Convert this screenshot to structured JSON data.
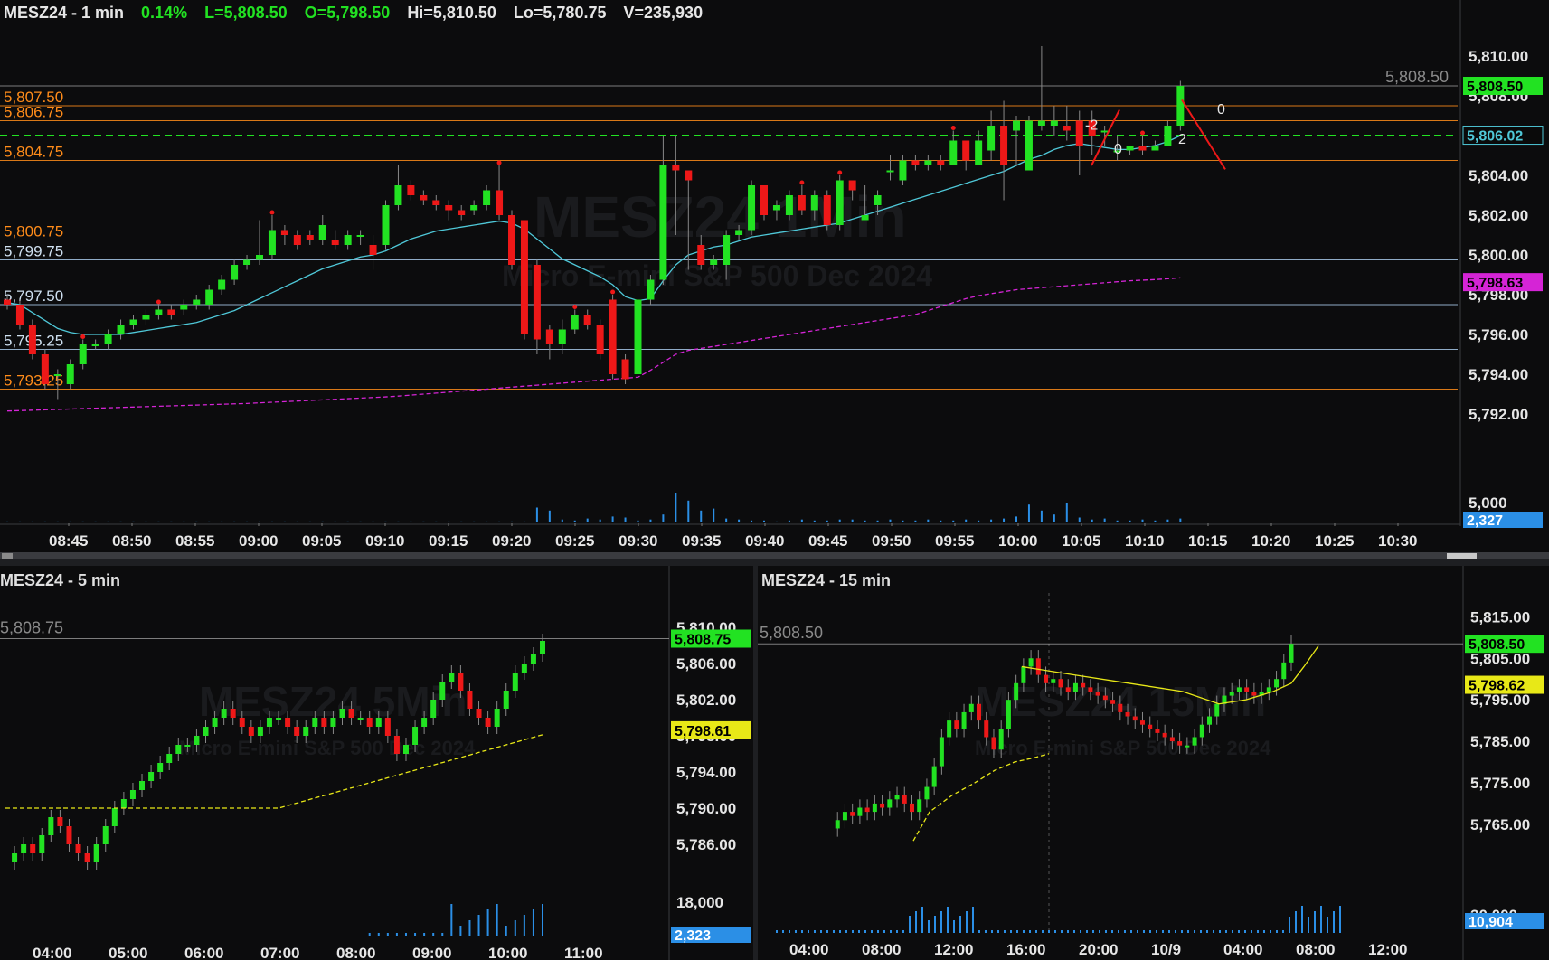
{
  "colors": {
    "up": "#22e222",
    "down": "#ee1818",
    "orange": "#ff8c1a",
    "grid": "#2a2c30",
    "ema_short": "#4fc8d8",
    "ema_long": "#d524d6",
    "yellow": "#e8e817",
    "volume": "#2b8fe6"
  },
  "chart_data": [
    {
      "type": "candlestick",
      "title": "MESZ24 - 1 min",
      "header": {
        "symbol": "MESZ24 - 1 min",
        "change": "0.14%",
        "last": "L=5,808.50",
        "open": "O=5,798.50",
        "high": "Hi=5,810.50",
        "low": "Lo=5,780.75",
        "volume": "V=235,930"
      },
      "watermark": {
        "symbol": "MESZ24 1Min",
        "name": "Micro E-mini S&P 500 Dec 2024"
      },
      "ylim": [
        5791,
        5811
      ],
      "y_ticks": [
        "5,810.00",
        "5,808.00",
        "5,806.00",
        "5,804.00",
        "5,802.00",
        "5,800.00",
        "5,798.00",
        "5,796.00",
        "5,794.00",
        "5,792.00"
      ],
      "x_ticks": [
        "08:45",
        "08:50",
        "08:55",
        "09:00",
        "09:05",
        "09:10",
        "09:15",
        "09:20",
        "09:25",
        "09:30",
        "09:35",
        "09:40",
        "09:45",
        "09:50",
        "09:55",
        "10:00",
        "10:05",
        "10:10",
        "10:15",
        "10:20",
        "10:25",
        "10:30"
      ],
      "levels": [
        {
          "label": "5,807.50",
          "value": 5807.5,
          "color": "orange"
        },
        {
          "label": "5,806.75",
          "value": 5806.75,
          "color": "orange"
        },
        {
          "label": "5,804.75",
          "value": 5804.75,
          "color": "orange"
        },
        {
          "label": "5,800.75",
          "value": 5800.75,
          "color": "orange"
        },
        {
          "label": "5,799.75",
          "value": 5799.75,
          "color": "white"
        },
        {
          "label": "5,797.50",
          "value": 5797.5,
          "color": "white"
        },
        {
          "label": "5,795.25",
          "value": 5795.25,
          "color": "white"
        },
        {
          "label": "5,793.25",
          "value": 5793.25,
          "color": "orange"
        }
      ],
      "last_price_line": "5,808.50",
      "price_tags": [
        {
          "text": "5,808.50",
          "bg": "#22e222",
          "fg": "#000",
          "value": 5808.5
        },
        {
          "text": "5,806.02",
          "bg": "#0a0a0a",
          "fg": "#4fc8d8",
          "value": 5806.02
        },
        {
          "text": "5,798.63",
          "bg": "#d524d6",
          "fg": "#000",
          "value": 5798.63
        }
      ],
      "volume_tick": "5,000",
      "volume_tag": "2,327",
      "swing_labels": [
        "-2",
        "0",
        "2",
        "0"
      ],
      "series": [
        {
          "name": "candles",
          "open": [
            5797.75,
            5797.5,
            5796.5,
            5795,
            5794,
            5793.5,
            5794.5,
            5795.5,
            5795.5,
            5796,
            5796.5,
            5796.75,
            5797,
            5797.25,
            5797.25,
            5797.5,
            5797.5,
            5798.25,
            5798.75,
            5799.5,
            5799.75,
            5800,
            5801.25,
            5801,
            5801,
            5800.75,
            5800.75,
            5800.5,
            5801,
            5800.5,
            5800.5,
            5802.5,
            5803.5,
            5803,
            5802.75,
            5802.5,
            5802.25,
            5802.25,
            5802.5,
            5803.25,
            5802,
            5801.75,
            5799.5,
            5796.25,
            5795.5,
            5796.25,
            5797,
            5796.5,
            5797.75,
            5794.75,
            5794,
            5797.75,
            5798.75,
            5804.5,
            5804.25,
            5800.5,
            5799.5,
            5799.5,
            5801,
            5801.25,
            5803.5,
            5802.25,
            5802,
            5803,
            5802.25,
            5803,
            5801.5,
            5803.75,
            5801.75,
            5802.5,
            5804.25,
            5803.75,
            5804.75,
            5804.5,
            5804.75,
            5804.5,
            5805.75,
            5804.5,
            5805.25,
            5806.5,
            5806.25,
            5804.25,
            5806.5,
            5806.5,
            5806.5,
            5806.75,
            5806.75,
            5806.25,
            5805.25,
            5805.25,
            5805.5,
            5805.25,
            5805.5,
            5806.5
          ],
          "close": [
            5797.5,
            5796.5,
            5795,
            5793.5,
            5794,
            5794.5,
            5795.5,
            5795.5,
            5796,
            5796.5,
            5796.75,
            5797,
            5797.25,
            5797,
            5797.5,
            5797.75,
            5798.25,
            5798.75,
            5799.5,
            5799.75,
            5800,
            5801.25,
            5801,
            5800.5,
            5800.75,
            5801.5,
            5800.5,
            5801,
            5801,
            5800,
            5802.5,
            5803.5,
            5803,
            5802.75,
            5802.5,
            5802.25,
            5802,
            5802.5,
            5803.25,
            5802,
            5799.5,
            5796,
            5795.75,
            5795.5,
            5796.25,
            5797,
            5796.5,
            5795,
            5794,
            5793.75,
            5797.75,
            5798.75,
            5804.5,
            5804.25,
            5803.75,
            5799.5,
            5799.75,
            5801,
            5801.25,
            5803.5,
            5802,
            5802.5,
            5803,
            5802.25,
            5803,
            5801.5,
            5803.75,
            5803.25,
            5802,
            5803,
            5804.25,
            5804.75,
            5804.5,
            5804.75,
            5804.5,
            5805.75,
            5804.75,
            5805.75,
            5806.5,
            5804.5,
            5806.75,
            5806.75,
            5806.75,
            5806.75,
            5806.25,
            5805.5,
            5806,
            5806.25,
            5805.25,
            5805.5,
            5805.25,
            5805.5,
            5806.5,
            5808.5
          ],
          "high": [
            5798,
            5797.75,
            5796.75,
            5795.25,
            5794.25,
            5794.75,
            5795.75,
            5795.75,
            5796.25,
            5796.75,
            5797,
            5797.25,
            5797.5,
            5797.5,
            5797.75,
            5798,
            5798.5,
            5799,
            5799.75,
            5800,
            5801.75,
            5802,
            5801.5,
            5801.25,
            5801.25,
            5802,
            5801.25,
            5801.25,
            5801.25,
            5801,
            5802.75,
            5804.5,
            5803.75,
            5803.25,
            5803,
            5802.75,
            5802.5,
            5802.75,
            5803.5,
            5804.5,
            5802.25,
            5801.75,
            5799.75,
            5796.5,
            5796.75,
            5797.25,
            5797.25,
            5796.75,
            5798,
            5795,
            5797.75,
            5799,
            5806,
            5806,
            5804,
            5801,
            5800,
            5801.25,
            5801.5,
            5803.75,
            5803.5,
            5802.75,
            5803.25,
            5803.5,
            5803.25,
            5803.25,
            5804,
            5803.75,
            5803.5,
            5803.25,
            5805,
            5805,
            5805,
            5805,
            5805,
            5806.25,
            5805.5,
            5806.25,
            5807.25,
            5807.75,
            5807,
            5807,
            5810.5,
            5807.5,
            5807.5,
            5807.25,
            5807.25,
            5806.5,
            5806,
            5805.5,
            5806,
            5805.75,
            5806.75,
            5808.75
          ],
          "low": [
            5797.25,
            5796.25,
            5794.75,
            5793.25,
            5792.75,
            5793.25,
            5794.25,
            5795.25,
            5795.25,
            5795.75,
            5796.25,
            5796.5,
            5796.75,
            5796.75,
            5797,
            5797.25,
            5797.25,
            5798,
            5798.5,
            5799.25,
            5799.5,
            5799.75,
            5800.5,
            5800.25,
            5800.5,
            5800.5,
            5800.25,
            5800.25,
            5800.5,
            5799.25,
            5800.25,
            5802.25,
            5802.75,
            5802.5,
            5802.25,
            5801.75,
            5801.75,
            5802,
            5802.25,
            5801.75,
            5799.25,
            5795.75,
            5795,
            5794.75,
            5795,
            5796,
            5796.25,
            5794.75,
            5793.75,
            5793.5,
            5793.75,
            5797.5,
            5798.5,
            5801,
            5799.25,
            5799.25,
            5799.25,
            5798.75,
            5800.75,
            5801,
            5801.75,
            5801.75,
            5801.75,
            5802,
            5801.75,
            5801.25,
            5801.25,
            5802.75,
            5801.75,
            5802,
            5803.75,
            5803.5,
            5804.25,
            5804.25,
            5804.25,
            5804.5,
            5804.25,
            5804.5,
            5804.75,
            5802.75,
            5804.5,
            5806,
            5806.25,
            5806,
            5805.75,
            5804,
            5805,
            5805.5,
            5804.75,
            5805,
            5805,
            5805.25,
            5805.5,
            5806.25
          ],
          "volume": [
            1,
            1,
            1,
            1,
            1,
            1,
            1,
            1,
            1,
            1,
            1,
            1,
            1,
            1,
            1,
            1,
            1,
            1,
            1,
            1,
            1,
            1,
            1,
            1,
            1,
            1,
            1,
            1,
            1,
            1,
            1,
            1,
            1,
            1,
            1,
            1,
            1,
            1,
            1,
            1,
            1,
            1,
            15,
            12,
            3,
            2,
            4,
            3,
            6,
            5,
            2,
            3,
            8,
            30,
            22,
            12,
            14,
            4,
            3,
            2,
            2,
            1,
            2,
            3,
            2,
            2,
            3,
            3,
            2,
            2,
            3,
            2,
            2,
            3,
            2,
            2,
            3,
            2,
            3,
            4,
            6,
            18,
            12,
            8,
            20,
            5,
            3,
            4,
            2,
            2,
            3,
            2,
            3,
            4
          ]
        },
        {
          "name": "ema_short",
          "values": [
            5797.6,
            5797.5,
            5797.1,
            5796.7,
            5796.3,
            5796.1,
            5796,
            5796,
            5796,
            5796,
            5796.1,
            5796.2,
            5796.3,
            5796.4,
            5796.5,
            5796.6,
            5796.8,
            5797,
            5797.2,
            5797.5,
            5797.8,
            5798.1,
            5798.4,
            5798.7,
            5799,
            5799.3,
            5799.5,
            5799.7,
            5799.9,
            5800,
            5800.2,
            5800.5,
            5800.8,
            5801,
            5801.2,
            5801.3,
            5801.4,
            5801.5,
            5801.6,
            5801.7,
            5801.6,
            5801.3,
            5800.8,
            5800.3,
            5799.8,
            5799.5,
            5799.2,
            5798.9,
            5798.5,
            5797.9,
            5797.7,
            5797.8,
            5798.7,
            5799.5,
            5800,
            5800.2,
            5800.4,
            5800.5,
            5800.7,
            5800.9,
            5801,
            5801.1,
            5801.2,
            5801.3,
            5801.4,
            5801.5,
            5801.6,
            5801.8,
            5802,
            5802.2,
            5802.4,
            5802.6,
            5802.8,
            5803,
            5803.2,
            5803.4,
            5803.6,
            5803.8,
            5804,
            5804.2,
            5804.5,
            5804.8,
            5805,
            5805.3,
            5805.5,
            5805.6,
            5805.5,
            5805.4,
            5805.3,
            5805.3,
            5805.4,
            5805.5,
            5805.7,
            5806
          ]
        },
        {
          "name": "ema_long",
          "values": [
            5792.15,
            5792.17,
            5792.19,
            5792.21,
            5792.23,
            5792.25,
            5792.27,
            5792.29,
            5792.31,
            5792.33,
            5792.35,
            5792.37,
            5792.39,
            5792.41,
            5792.43,
            5792.45,
            5792.47,
            5792.49,
            5792.51,
            5792.53,
            5792.56,
            5792.59,
            5792.62,
            5792.65,
            5792.68,
            5792.71,
            5792.74,
            5792.77,
            5792.8,
            5792.83,
            5792.86,
            5792.9,
            5792.95,
            5793,
            5793.05,
            5793.1,
            5793.15,
            5793.2,
            5793.25,
            5793.3,
            5793.35,
            5793.4,
            5793.45,
            5793.5,
            5793.55,
            5793.6,
            5793.65,
            5793.7,
            5793.75,
            5793.8,
            5793.85,
            5794.2,
            5794.6,
            5795,
            5795.2,
            5795.3,
            5795.4,
            5795.5,
            5795.6,
            5795.7,
            5795.8,
            5795.9,
            5796,
            5796.1,
            5796.2,
            5796.3,
            5796.4,
            5796.5,
            5796.6,
            5796.7,
            5796.8,
            5796.9,
            5797,
            5797.2,
            5797.4,
            5797.6,
            5797.8,
            5797.95,
            5798.05,
            5798.15,
            5798.25,
            5798.3,
            5798.35,
            5798.4,
            5798.45,
            5798.5,
            5798.55,
            5798.6,
            5798.65,
            5798.7,
            5798.73,
            5798.76,
            5798.8,
            5798.85
          ]
        }
      ]
    },
    {
      "type": "candlestick",
      "title": "MESZ24 - 5 min",
      "watermark": {
        "symbol": "MESZ24 5Min",
        "name": "Micro E-mini S&P 500 Dec 2024"
      },
      "last_price_line": "5,808.75",
      "ylim": [
        5782,
        5812
      ],
      "y_ticks": [
        "5,810.00",
        "5,806.00",
        "5,802.00",
        "5,798.00",
        "5,794.00",
        "5,790.00",
        "5,786.00"
      ],
      "x_ticks": [
        "04:00",
        "05:00",
        "06:00",
        "07:00",
        "08:00",
        "09:00",
        "10:00",
        "11:00"
      ],
      "price_tags": [
        {
          "text": "5,808.75",
          "bg": "#22e222",
          "fg": "#000",
          "value": 5808.75
        },
        {
          "text": "5,798.61",
          "bg": "#e8e817",
          "fg": "#000",
          "value": 5798.61
        }
      ],
      "volume_tick": "18,000",
      "volume_tag": "2,323"
    },
    {
      "type": "candlestick",
      "title": "MESZ24 - 15 min",
      "watermark": {
        "symbol": "MESZ24 15Min",
        "name": "Micro E-mini S&P 500 Dec 2024"
      },
      "last_price_line": "5,808.50",
      "ylim": [
        5758,
        5819
      ],
      "y_ticks": [
        "5,815.00",
        "5,805.00",
        "5,795.00",
        "5,785.00",
        "5,775.00",
        "5,765.00"
      ],
      "x_ticks": [
        "04:00",
        "08:00",
        "12:00",
        "16:00",
        "20:00",
        "10/9",
        "04:00",
        "08:00",
        "12:00"
      ],
      "price_tags": [
        {
          "text": "5,808.50",
          "bg": "#22e222",
          "fg": "#000",
          "value": 5808.5
        },
        {
          "text": "5,798.62",
          "bg": "#e8e817",
          "fg": "#000",
          "value": 5798.62
        }
      ],
      "volume_tick": "30,000",
      "volume_tag": "10,904"
    }
  ]
}
